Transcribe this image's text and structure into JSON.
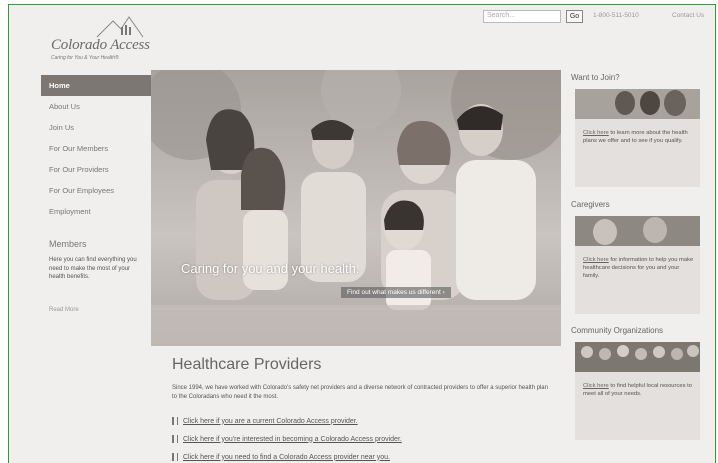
{
  "header": {
    "logo_name": "Colorado Access",
    "logo_tagline": "Caring for You & Your Health®",
    "search_placeholder": "Search...",
    "go_label": "Go",
    "phone": "1-800-511-5010",
    "contact_label": "Contact Us"
  },
  "nav": {
    "items": [
      {
        "label": "Home",
        "active": true
      },
      {
        "label": "About Us"
      },
      {
        "label": "Join Us"
      },
      {
        "label": "For Our Members"
      },
      {
        "label": "For Our Providers"
      },
      {
        "label": "For Our Employees"
      },
      {
        "label": "Employment"
      }
    ]
  },
  "members": {
    "title": "Members",
    "text": "Here you can find everything you need to make the most of your health benefits.",
    "read_more": "Read More"
  },
  "hero": {
    "caption": "Caring for you and your health.",
    "link": "Find out what makes us different ›"
  },
  "providers": {
    "title": "Healthcare Providers",
    "text": "Since 1994, we have worked with Colorado's safety net providers and a diverse network of contracted providers to offer a superior health plan to the Coloradans who need it the most.",
    "links": [
      "Click here if you are a current Colorado Access provider.",
      "Click here if you're interested in becoming a Colorado Access provider.",
      "Click here if you need to find a Colorado Access provider near you."
    ]
  },
  "sidebar": {
    "join": {
      "heading": "Want to Join?",
      "link": "Click here",
      "text": " to learn more about the health plans we offer and to see if you qualify."
    },
    "caregivers": {
      "heading": "Caregivers",
      "link": "Click here",
      "text": " for information to help you make healthcare decisions for you and your family."
    },
    "community": {
      "heading": "Community Organizations",
      "link": "Click here",
      "text": " to find helpful local resources to meet all of your needs."
    }
  },
  "colors": {
    "nav_active": "#7d7773",
    "page_bg": "#f1efed",
    "frame_border": "#2e9a3a"
  }
}
